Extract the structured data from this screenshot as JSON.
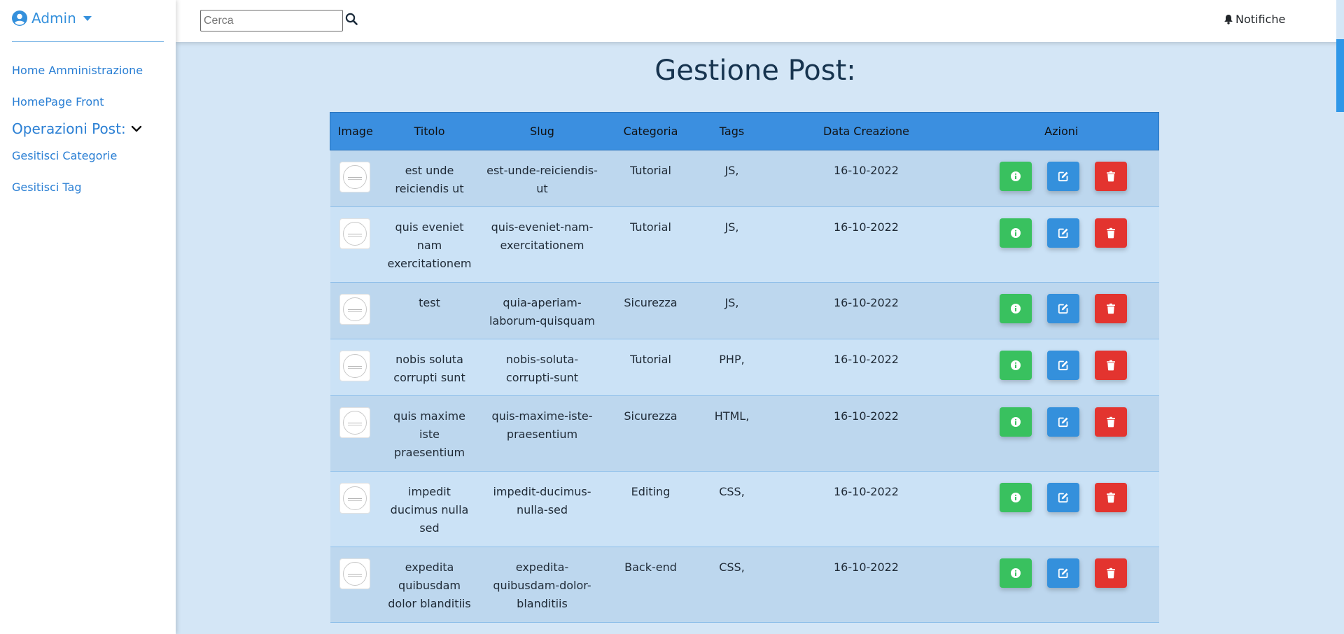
{
  "sidebar": {
    "admin_label": "Admin",
    "links": [
      {
        "label": "Home Amministrazione"
      },
      {
        "label": "HomePage Front"
      }
    ],
    "section_label": "Operazioni Post:",
    "sub_links": [
      {
        "label": "Gesitisci Categorie"
      },
      {
        "label": "Gesitisci Tag"
      }
    ]
  },
  "topbar": {
    "search_placeholder": "Cerca",
    "search_value": "",
    "notifications_label": "Notifiche"
  },
  "main": {
    "title": "Gestione Post:",
    "table": {
      "headers": [
        "Image",
        "Titolo",
        "Slug",
        "Categoria",
        "Tags",
        "Data Creazione",
        "Azioni"
      ],
      "rows": [
        {
          "title": "est unde reiciendis ut",
          "slug": "est-unde-reiciendis-ut",
          "category": "Tutorial",
          "tags": "JS,",
          "date": "16-10-2022"
        },
        {
          "title": "quis eveniet nam exercitationem",
          "slug": "quis-eveniet-nam-exercitationem",
          "category": "Tutorial",
          "tags": "JS,",
          "date": "16-10-2022"
        },
        {
          "title": "test",
          "slug": "quia-aperiam-laborum-quisquam",
          "category": "Sicurezza",
          "tags": "JS,",
          "date": "16-10-2022"
        },
        {
          "title": "nobis soluta corrupti sunt",
          "slug": "nobis-soluta-corrupti-sunt",
          "category": "Tutorial",
          "tags": "PHP,",
          "date": "16-10-2022"
        },
        {
          "title": "quis maxime iste praesentium",
          "slug": "quis-maxime-iste-praesentium",
          "category": "Sicurezza",
          "tags": "HTML,",
          "date": "16-10-2022"
        },
        {
          "title": "impedit ducimus nulla sed",
          "slug": "impedit-ducimus-nulla-sed",
          "category": "Editing",
          "tags": "CSS,",
          "date": "16-10-2022"
        },
        {
          "title": "expedita quibusdam dolor blanditiis",
          "slug": "expedita-quibusdam-dolor-blanditiis",
          "category": "Back-end",
          "tags": "CSS,",
          "date": "16-10-2022"
        }
      ]
    }
  },
  "icons": {
    "admin": "user-circle-icon",
    "admin_caret": "caret-down-icon",
    "section": "chevron-down-icon",
    "search": "search-icon",
    "notifications": "bell-icon",
    "show": "info-circle-icon",
    "edit": "edit-icon",
    "delete": "trash-icon"
  },
  "colors": {
    "primary": "#3490dc",
    "success": "#39c15f",
    "danger": "#e3342f",
    "page_bg": "#d4e6f6",
    "table_header": "#3b8fe0"
  }
}
